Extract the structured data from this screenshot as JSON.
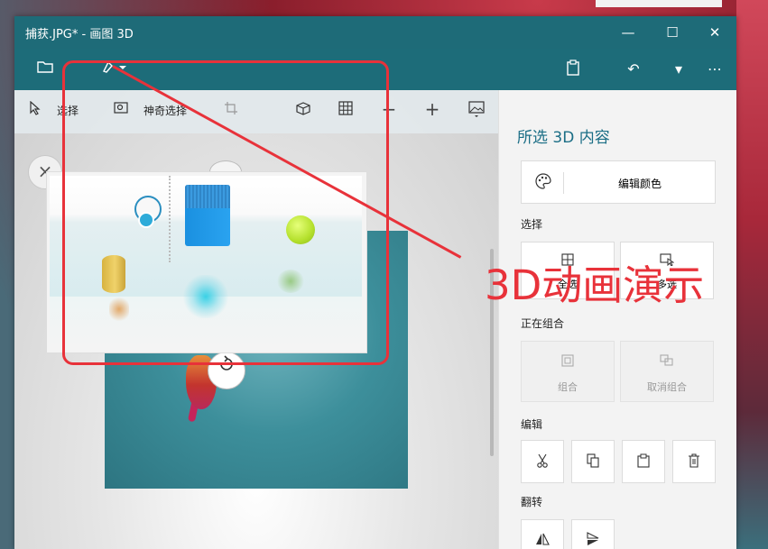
{
  "window": {
    "title": "捕获.JPG* - 画图 3D",
    "minimize_glyph": "—",
    "maximize_glyph": "☐",
    "close_glyph": "✕"
  },
  "appbar": {
    "more_glyph": "⋯",
    "undo_glyph": "↶",
    "dropdown_glyph": "▾"
  },
  "toolbar": {
    "select_label": "选择",
    "magic_select_label": "神奇选择",
    "minus_glyph": "−",
    "plus_glyph": "+"
  },
  "panel": {
    "title": "所选 3D 内容",
    "edit_color_label": "编辑颜色",
    "select_section": "选择",
    "select_all_label": "全选",
    "multi_select_label": "多选",
    "group_section": "正在组合",
    "group_label": "组合",
    "ungroup_label": "取消组合",
    "edit_section": "编辑",
    "flip_section": "翻转"
  },
  "annotation": {
    "text": "3D动画演示",
    "color": "#e8323a"
  },
  "colors": {
    "accent": "#1e6b78",
    "panel_title": "#1b6e86"
  }
}
